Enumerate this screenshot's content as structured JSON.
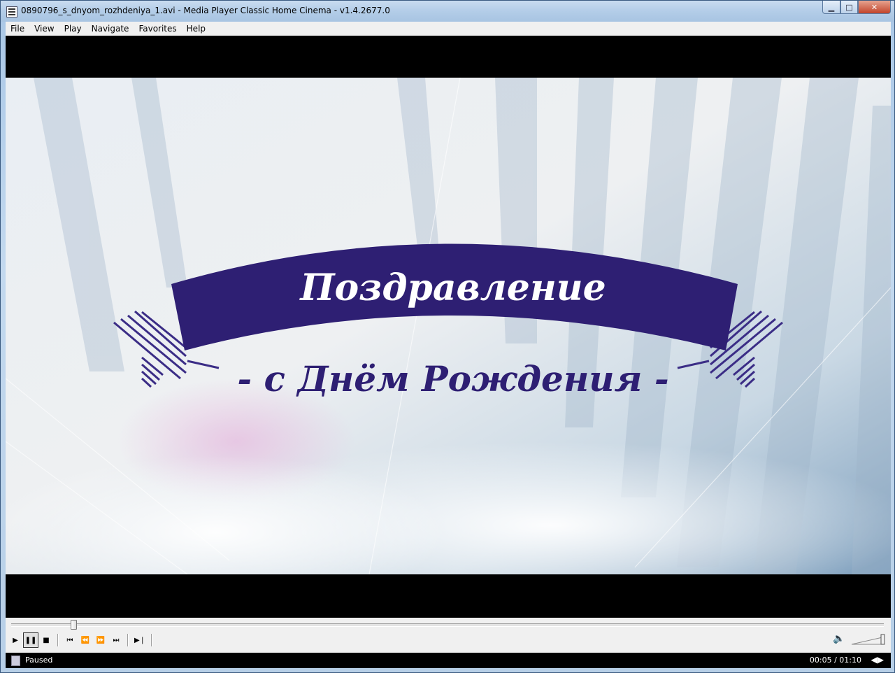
{
  "window": {
    "title": "0890796_s_dnyom_rozhdeniya_1.avi - Media Player Classic Home Cinema - v1.4.2677.0",
    "min_glyph": "▁",
    "max_glyph": "□",
    "close_glyph": "✕"
  },
  "menu": {
    "items": [
      {
        "label": "File"
      },
      {
        "label": "View"
      },
      {
        "label": "Play"
      },
      {
        "label": "Navigate"
      },
      {
        "label": "Favorites"
      },
      {
        "label": "Help"
      }
    ]
  },
  "video": {
    "banner_text": "Поздравление",
    "subtitle_text": "- с Днём Рождения -",
    "banner_color": "#2e1f73"
  },
  "controls": {
    "seek_position_fraction": 0.071,
    "play_glyph": "▶",
    "pause_glyph": "❚❚",
    "stop_glyph": "■",
    "prev_glyph": "⏮",
    "rewind_glyph": "⏪",
    "forward_glyph": "⏩",
    "next_glyph": "⏭",
    "frame_step_glyph": "▶❘",
    "volume_glyph": "🔈"
  },
  "status": {
    "state": "Paused",
    "time": "00:05 / 01:10"
  }
}
